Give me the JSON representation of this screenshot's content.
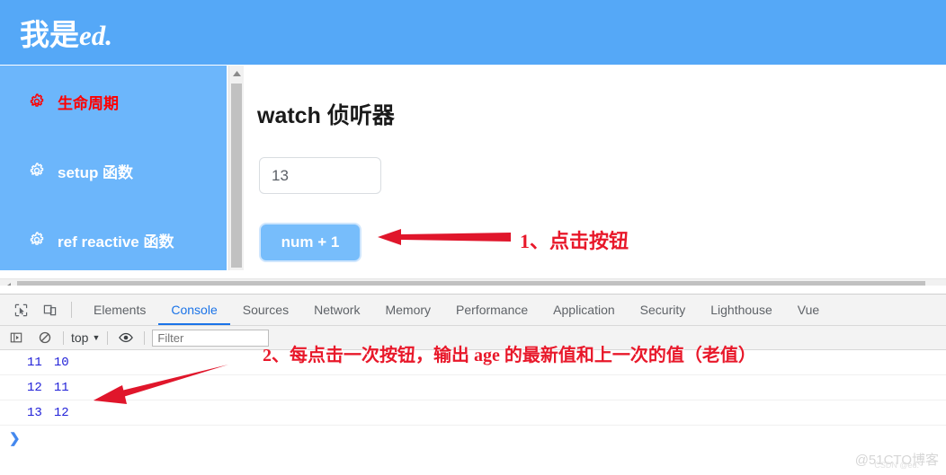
{
  "site": {
    "logo_cn": "我是",
    "logo_en": "ed."
  },
  "sidebar": {
    "items": [
      {
        "label": "生命周期",
        "icon": "gear-icon",
        "active": true,
        "color": "#ff0000"
      },
      {
        "label": "setup 函数",
        "icon": "gear-icon",
        "active": false,
        "color": "#ffffff"
      },
      {
        "label": "ref reactive 函数",
        "icon": "gear-icon",
        "active": false,
        "color": "#ffffff"
      }
    ]
  },
  "main": {
    "title": "watch 侦听器",
    "input_value": "13",
    "button_label": "num + 1"
  },
  "annotations": {
    "one": "1、点击按钮",
    "two": "2、每点击一次按钮，输出 age 的最新值和上一次的值（老值）",
    "color": "#e8182a"
  },
  "devtools": {
    "inspect_icon": "inspect-element-icon",
    "device_icon": "device-toolbar-icon",
    "tabs": [
      {
        "label": "Elements",
        "active": false
      },
      {
        "label": "Console",
        "active": true
      },
      {
        "label": "Sources",
        "active": false
      },
      {
        "label": "Network",
        "active": false
      },
      {
        "label": "Memory",
        "active": false
      },
      {
        "label": "Performance",
        "active": false
      },
      {
        "label": "Application",
        "active": false
      },
      {
        "label": "Security",
        "active": false
      },
      {
        "label": "Lighthouse",
        "active": false
      },
      {
        "label": "Vue",
        "active": false
      }
    ],
    "active_tab": "Console",
    "accent_color": "#1a73e8",
    "toolbar": {
      "sidebar_toggle_icon": "console-sidebar-icon",
      "clear_icon": "clear-console-icon",
      "context": "top",
      "context_caret": "▼",
      "eye_icon": "eye-icon",
      "filter_placeholder": "Filter"
    },
    "console_rows": [
      {
        "new_value": "11",
        "old_value": "10"
      },
      {
        "new_value": "12",
        "old_value": "11"
      },
      {
        "new_value": "13",
        "old_value": "12"
      }
    ],
    "prompt_chevron": "❯"
  },
  "watermark": {
    "main": "@51CTO博客",
    "sub": "CSDN @ed."
  }
}
